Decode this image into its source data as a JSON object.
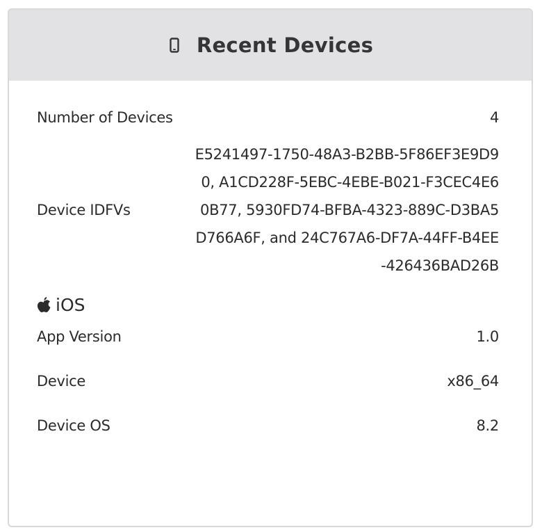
{
  "header": {
    "title": "Recent Devices",
    "icon": "mobile-phone-icon"
  },
  "summary": {
    "count_label": "Number of Devices",
    "count_value": "4",
    "idfv_label": "Device IDFVs",
    "idfv_value": "E5241497-1750-48A3-B2BB-5F86EF3E9D90, A1CD228F-5EBC-4EBE-B021-F3CEC4E60B77, 5930FD74-BFBA-4323-889C-D3BA5D766A6F, and 24C767A6-DF7A-44FF-B4EE-426436BAD26B"
  },
  "platform": {
    "icon": "apple-icon",
    "name": "iOS",
    "rows": [
      {
        "label": "App Version",
        "value": "1.0"
      },
      {
        "label": "Device",
        "value": "x86_64"
      },
      {
        "label": "Device OS",
        "value": "8.2"
      }
    ]
  },
  "colors": {
    "header_bg": "#e2e2e4",
    "border": "#d9d9d9",
    "text": "#2b2b2b"
  }
}
